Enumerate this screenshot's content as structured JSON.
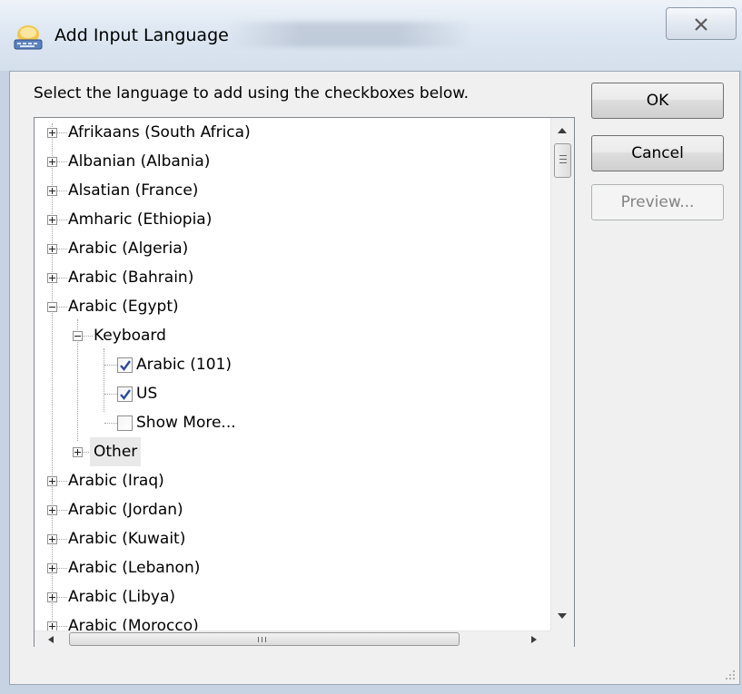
{
  "window": {
    "title": "Add Input Language",
    "close_symbol": "✕"
  },
  "instruction": "Select the language to add using the checkboxes below.",
  "buttons": {
    "ok": "OK",
    "cancel": "Cancel",
    "preview": "Preview..."
  },
  "tree": {
    "items": [
      {
        "label": "Afrikaans (South Africa)",
        "expander": "plus"
      },
      {
        "label": "Albanian (Albania)",
        "expander": "plus"
      },
      {
        "label": "Alsatian (France)",
        "expander": "plus"
      },
      {
        "label": "Amharic (Ethiopia)",
        "expander": "plus"
      },
      {
        "label": "Arabic (Algeria)",
        "expander": "plus"
      },
      {
        "label": "Arabic (Bahrain)",
        "expander": "plus"
      },
      {
        "label": "Arabic (Egypt)",
        "expander": "minus"
      },
      {
        "label": "Keyboard",
        "expander": "minus"
      },
      {
        "label": "Arabic (101)",
        "checked": true
      },
      {
        "label": "US",
        "checked": true
      },
      {
        "label": "Show More...",
        "checked": false
      },
      {
        "label": "Other",
        "expander": "plus"
      },
      {
        "label": "Arabic (Iraq)",
        "expander": "plus"
      },
      {
        "label": "Arabic (Jordan)",
        "expander": "plus"
      },
      {
        "label": "Arabic (Kuwait)",
        "expander": "plus"
      },
      {
        "label": "Arabic (Lebanon)",
        "expander": "plus"
      },
      {
        "label": "Arabic (Libya)",
        "expander": "plus"
      },
      {
        "label": "Arabic (Morocco)",
        "expander": "plus"
      }
    ]
  },
  "scrollbars": {
    "horizontal_grip": "III"
  },
  "icons": {
    "app": "keyboard-language-icon",
    "close": "close-icon",
    "expand": "plus-box-icon",
    "collapse": "minus-box-icon",
    "check": "checkmark-icon",
    "scroll_up": "arrow-up-icon",
    "scroll_down": "arrow-down-icon",
    "scroll_left": "arrow-left-icon",
    "scroll_right": "arrow-right-icon",
    "resize": "resize-grip-icon"
  },
  "colors": {
    "title_bar": "#dfe8f3",
    "client_bg": "#f0f0f0",
    "check": "#2b4c9a",
    "disabled_text": "#838383"
  }
}
